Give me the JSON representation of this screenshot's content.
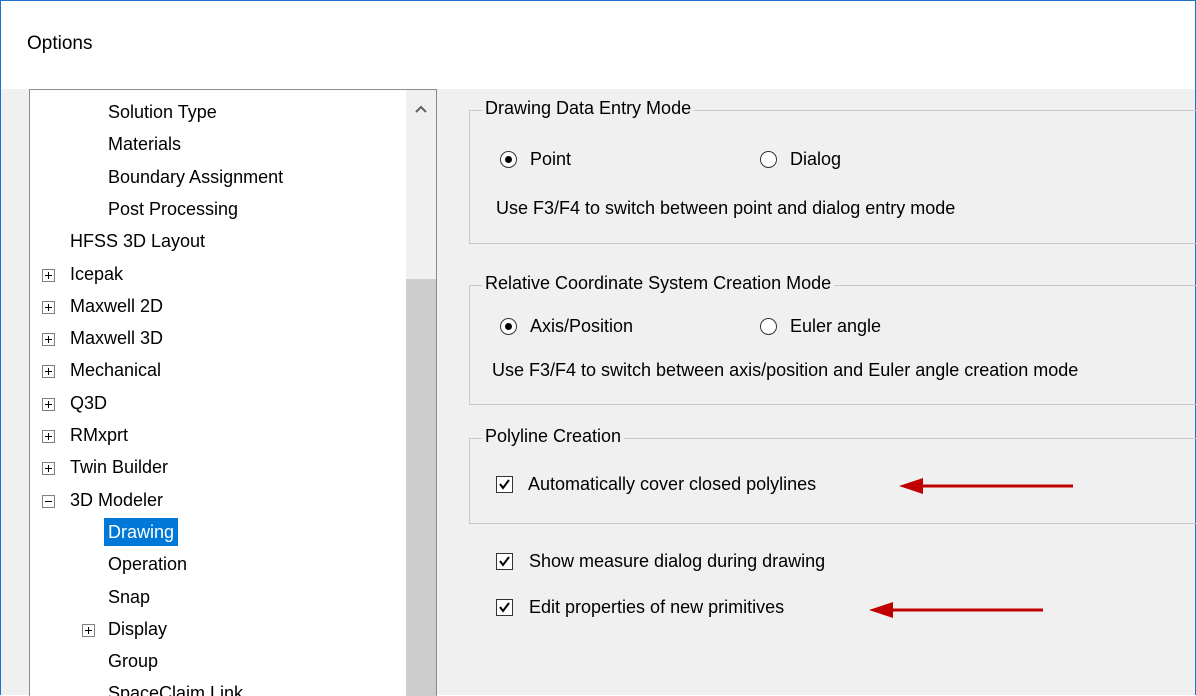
{
  "window": {
    "title": "Options"
  },
  "tree": {
    "items": [
      {
        "label": "Solution Type",
        "level": 2,
        "expander": "none",
        "selected": false
      },
      {
        "label": "Materials",
        "level": 2,
        "expander": "none",
        "selected": false
      },
      {
        "label": "Boundary Assignment",
        "level": 2,
        "expander": "none",
        "selected": false
      },
      {
        "label": "Post Processing",
        "level": 2,
        "expander": "none",
        "selected": false
      },
      {
        "label": "HFSS 3D Layout",
        "level": 1,
        "expander": "none",
        "selected": false
      },
      {
        "label": "Icepak",
        "level": 1,
        "expander": "plus",
        "selected": false
      },
      {
        "label": "Maxwell 2D",
        "level": 1,
        "expander": "plus",
        "selected": false
      },
      {
        "label": "Maxwell 3D",
        "level": 1,
        "expander": "plus",
        "selected": false
      },
      {
        "label": "Mechanical",
        "level": 1,
        "expander": "plus",
        "selected": false
      },
      {
        "label": "Q3D",
        "level": 1,
        "expander": "plus",
        "selected": false
      },
      {
        "label": "RMxprt",
        "level": 1,
        "expander": "plus",
        "selected": false
      },
      {
        "label": "Twin Builder",
        "level": 1,
        "expander": "plus",
        "selected": false
      },
      {
        "label": "3D Modeler",
        "level": 1,
        "expander": "minus",
        "selected": false
      },
      {
        "label": "Drawing",
        "level": 2,
        "expander": "none",
        "selected": true
      },
      {
        "label": "Operation",
        "level": 2,
        "expander": "none",
        "selected": false
      },
      {
        "label": "Snap",
        "level": 2,
        "expander": "none",
        "selected": false
      },
      {
        "label": "Display",
        "level": 2,
        "expander": "plus",
        "selected": false
      },
      {
        "label": "Group",
        "level": 2,
        "expander": "none",
        "selected": false
      },
      {
        "label": "SpaceClaim Link",
        "level": 2,
        "expander": "none",
        "selected": false
      }
    ]
  },
  "drawing_mode": {
    "title": "Drawing Data Entry Mode",
    "option_point": "Point",
    "option_dialog": "Dialog",
    "selected": "Point",
    "hint": "Use F3/F4 to switch between point and dialog entry mode"
  },
  "relative_cs": {
    "title": "Relative Coordinate System Creation Mode",
    "option_axis": "Axis/Position",
    "option_euler": "Euler angle",
    "selected": "Axis/Position",
    "hint": "Use F3/F4 to switch between axis/position and Euler angle creation mode"
  },
  "polyline": {
    "title": "Polyline Creation",
    "auto_cover_label": "Automatically cover closed polylines",
    "auto_cover_checked": true
  },
  "options": {
    "show_measure_label": "Show measure dialog during drawing",
    "show_measure_checked": true,
    "edit_props_label": "Edit properties of new primitives",
    "edit_props_checked": true
  },
  "colors": {
    "selection": "#0078d7",
    "annotation_arrow": "#c00000",
    "window_border": "#1b74c9"
  }
}
